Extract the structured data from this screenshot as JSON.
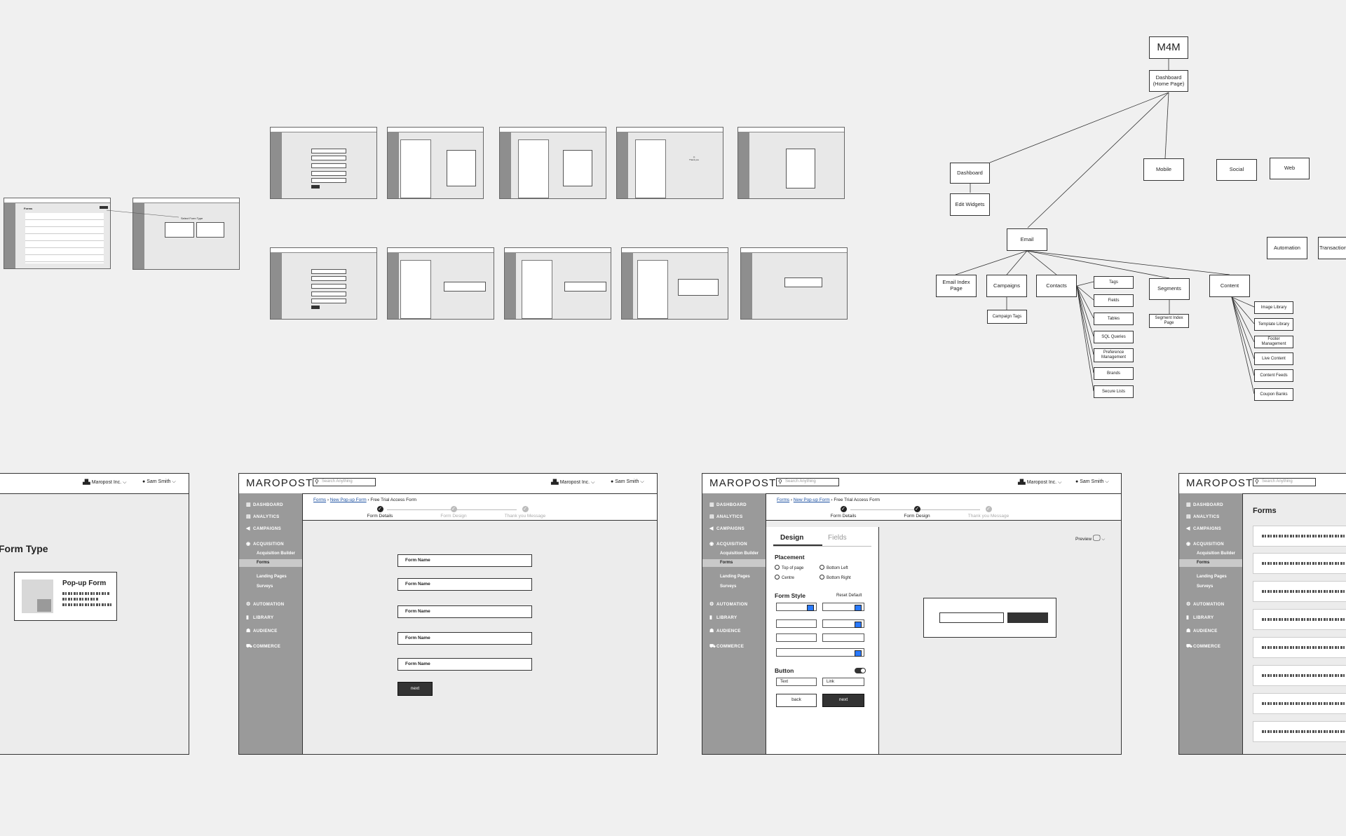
{
  "app": {
    "brand": "MAROPOST",
    "search_placeholder": "Search Anything",
    "org": "Maropost Inc.",
    "user": "Sam Smith"
  },
  "sitemap": {
    "root": "M4M",
    "home": "Dashboard (Home Page)",
    "dashboard": "Dashboard",
    "edit_widgets": "Edit Widgets",
    "mobile": "Mobile",
    "social": "Social",
    "web": "Web",
    "email": "Email",
    "automation": "Automation",
    "transactional": "Transactional",
    "email_index": "Email Index Page",
    "campaigns": "Campaigns",
    "campaign_tags": "Campaign Tags",
    "contacts": "Contacts",
    "contacts_children": [
      "Tags",
      "Fields",
      "Tables",
      "SQL Queries",
      "Preference Management",
      "Brands",
      "Secure Lists"
    ],
    "segments": "Segments",
    "segment_index": "Segment Index Page",
    "content": "Content",
    "content_children": [
      "Image Library",
      "Template Library",
      "Footer Management",
      "Live Content",
      "Content Feeds",
      "Coupon Banks"
    ]
  },
  "nav": {
    "dashboard": "DASHBOARD",
    "analytics": "ANALYTICS",
    "campaigns": "CAMPAIGNS",
    "acquisition": "ACQUISITION",
    "acquisition_builder": "Acquisition Builder",
    "forms": "Forms",
    "landing_pages": "Landing Pages",
    "surveys": "Surveys",
    "automation": "AUTOMATION",
    "library": "LIBRARY",
    "audience": "AUDIENCE",
    "commerce": "COMMERCE"
  },
  "form_type": {
    "title": "Form Type",
    "popup_label": "Pop-up Form"
  },
  "form_details": {
    "crumb_forms": "Forms",
    "crumb_new": "New Pop-up Form",
    "crumb_current": "Free Trial Access Form",
    "steps": [
      "Form Details",
      "Form Design",
      "Thank you Message"
    ],
    "field_labels": [
      "Form Name",
      "Form Name",
      "Form Name",
      "Form Name",
      "Form Name"
    ],
    "next": "next"
  },
  "form_design": {
    "tab_design": "Design",
    "tab_fields": "Fields",
    "placement": "Placement",
    "placement_options": [
      "Top of page",
      "Bottom Left",
      "Centre",
      "Bottom Right"
    ],
    "form_style": "Form Style",
    "reset": "Reset Default",
    "button": "Button",
    "text": "Text",
    "link": "Link",
    "back": "back",
    "next": "next",
    "preview": "Preview"
  },
  "forms_list": {
    "title": "Forms"
  }
}
